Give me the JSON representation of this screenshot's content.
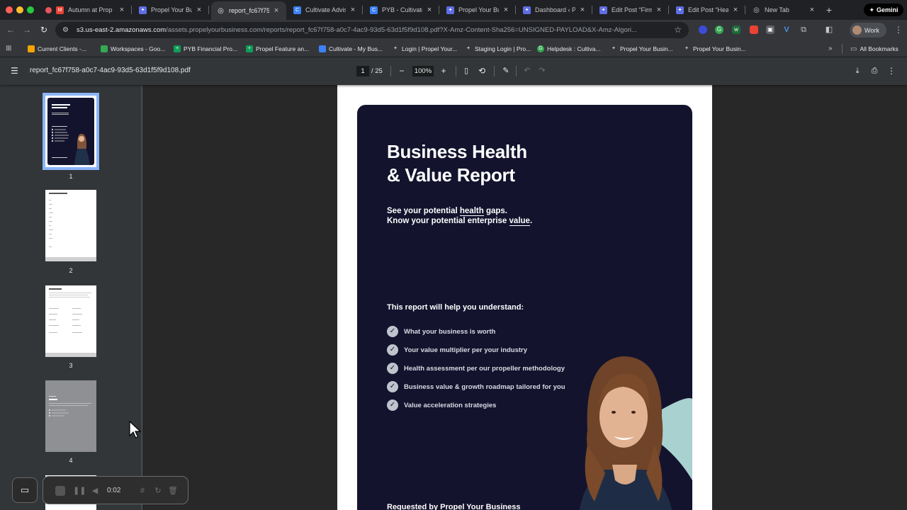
{
  "browser": {
    "tabs": [
      {
        "title": "Autumn at Prop",
        "color": "#e8555b",
        "glyph": "M"
      },
      {
        "title": "Propel Your Bus",
        "color": "#5f6ee6",
        "glyph": "✦"
      },
      {
        "title": "report_fc67f75",
        "color": "#9aa0a6",
        "glyph": "◎"
      },
      {
        "title": "Cultivate Advis",
        "color": "#3b82f6",
        "glyph": "C"
      },
      {
        "title": "PYB - Cultivate",
        "color": "#3b82f6",
        "glyph": "C"
      },
      {
        "title": "Propel Your Bus",
        "color": "#5f6ee6",
        "glyph": "✦"
      },
      {
        "title": "Dashboard ‹ Pr",
        "color": "#5f6ee6",
        "glyph": "✦"
      },
      {
        "title": "Edit Post “Firm",
        "color": "#5f6ee6",
        "glyph": "✦"
      },
      {
        "title": "Edit Post “Healt",
        "color": "#5f6ee6",
        "glyph": "✦"
      },
      {
        "title": "New Tab",
        "color": "#9aa0a6",
        "glyph": "◎"
      }
    ],
    "gemini_label": "Gemini",
    "url_host": "s3.us-east-2.amazonaws.com",
    "url_path": "/assets.propelyourbusiness.com/reports/report_fc67f758-a0c7-4ac9-93d5-63d1f5f9d108.pdf?X-Amz-Content-Sha256=UNSIGNED-PAYLOAD&X-Amz-Algori...",
    "profile_label": "Work",
    "bookmarks": [
      {
        "label": "Current Clients -...",
        "color": "#f4a300"
      },
      {
        "label": "Workspaces - Goo...",
        "color": "#34a853"
      },
      {
        "label": "PYB Financial Pro...",
        "color": "#0f9d58"
      },
      {
        "label": "Propel Feature an...",
        "color": "#0f9d58"
      },
      {
        "label": "Cultivate - My Bus...",
        "color": "#3b82f6"
      },
      {
        "label": "Login | Propel Your...",
        "color": "#5f6ee6"
      },
      {
        "label": "Staging Login | Pro...",
        "color": "#5f6ee6"
      },
      {
        "label": "Helpdesk : Cultiva...",
        "color": "#34a853"
      },
      {
        "label": "Propel Your Busin...",
        "color": "#5f6ee6"
      },
      {
        "label": "Propel Your Busin...",
        "color": "#5f6ee6"
      }
    ],
    "all_bookmarks_label": "All Bookmarks"
  },
  "pdf_viewer": {
    "filename": "report_fc67f758-a0c7-4ac9-93d5-63d1f5f9d108.pdf",
    "current_page": "1",
    "total_pages": "/ 25",
    "zoom": "100%",
    "thumbnails": [
      {
        "number": "1",
        "selected": true
      },
      {
        "number": "2",
        "selected": false
      },
      {
        "number": "3",
        "selected": false
      },
      {
        "number": "4",
        "selected": false
      }
    ]
  },
  "report": {
    "title_line1": "Business Health",
    "title_line2": "& Value Report",
    "sub_a": "See your potential ",
    "sub_a_ul": "health",
    "sub_a_end": " gaps.",
    "sub_b": "Know your potential enterprise ",
    "sub_b_ul": "value",
    "sub_b_end": ".",
    "understand_heading": "This report will help you understand:",
    "benefits": [
      "What your business is worth",
      "Your value multiplier per your industry",
      "Health assessment per our propeller methodology",
      "Business value & growth roadmap tailored for you",
      "Value acceleration strategies"
    ],
    "requested_by": "Requested by Propel Your Business"
  },
  "recorder": {
    "elapsed": "0:02"
  }
}
